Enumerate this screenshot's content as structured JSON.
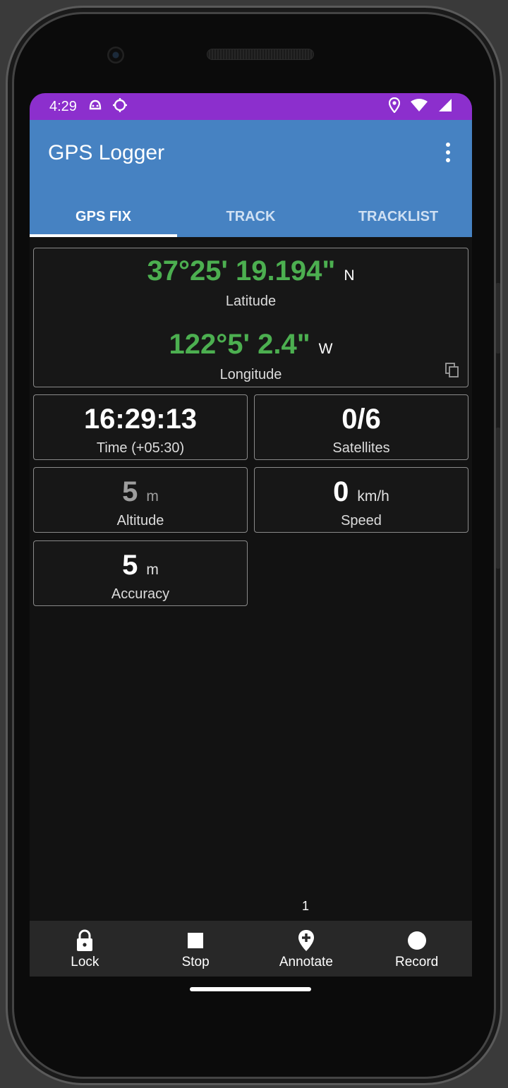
{
  "status_bar": {
    "time": "4:29",
    "icons_left": [
      "android-face-icon",
      "sync-circle-icon"
    ],
    "icons_right": [
      "location-pin-icon",
      "wifi-icon",
      "cell-signal-icon"
    ]
  },
  "app_bar": {
    "title": "GPS Logger",
    "menu_icon": "more-vertical-icon",
    "color": "#4682c2"
  },
  "tabs": [
    {
      "label": "GPS FIX",
      "active": true
    },
    {
      "label": "TRACK",
      "active": false
    },
    {
      "label": "TRACKLIST",
      "active": false
    }
  ],
  "coordinates": {
    "latitude": {
      "value": "37°25' 19.194\"",
      "hemisphere": "N",
      "label": "Latitude"
    },
    "longitude": {
      "value": "122°5' 2.4\"",
      "hemisphere": "W",
      "label": "Longitude"
    },
    "copy_icon": "copy-icon",
    "value_color": "#4caf50"
  },
  "stats": {
    "time": {
      "value": "16:29:13",
      "label": "Time (+05:30)"
    },
    "satellites": {
      "value": "0/6",
      "label": "Satellites"
    },
    "altitude": {
      "value": "5",
      "unit": "m",
      "label": "Altitude"
    },
    "speed": {
      "value": "0",
      "unit": "km/h",
      "label": "Speed"
    },
    "accuracy": {
      "value": "5",
      "unit": "m",
      "label": "Accuracy"
    }
  },
  "page_indicator": "1",
  "bottom_bar": {
    "lock": {
      "label": "Lock",
      "icon": "lock-icon"
    },
    "stop": {
      "label": "Stop",
      "icon": "stop-icon"
    },
    "annotate": {
      "label": "Annotate",
      "icon": "add-location-icon"
    },
    "record": {
      "label": "Record",
      "icon": "record-icon"
    }
  },
  "colors": {
    "status_bar": "#8c2fcd",
    "background": "#121212",
    "bottom_bar": "#282828"
  }
}
